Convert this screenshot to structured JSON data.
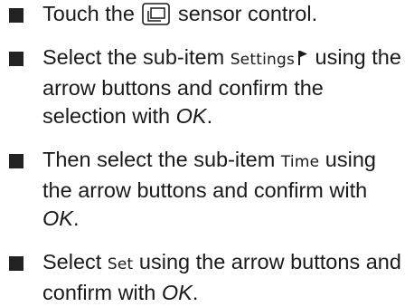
{
  "steps": [
    {
      "prefix": "Touch the",
      "icon": "menu-sensor-icon",
      "suffix": "sensor control."
    },
    {
      "prefix": "Select the sub-item",
      "display": "Settings",
      "icon": "flag-icon",
      "middle": "using the arrow buttons and confirm the selection with",
      "ok": "OK",
      "end": "."
    },
    {
      "prefix": "Then select the sub-item",
      "display": "Time",
      "middle": "using the arrow buttons and confirm with",
      "ok": "OK",
      "end": "."
    },
    {
      "prefix": "Select",
      "display": "Set",
      "middle": "using the arrow buttons and confirm with",
      "ok": "OK",
      "end": "."
    }
  ],
  "colors": {
    "text": "#1a1a1a",
    "bullet": "#222222"
  }
}
